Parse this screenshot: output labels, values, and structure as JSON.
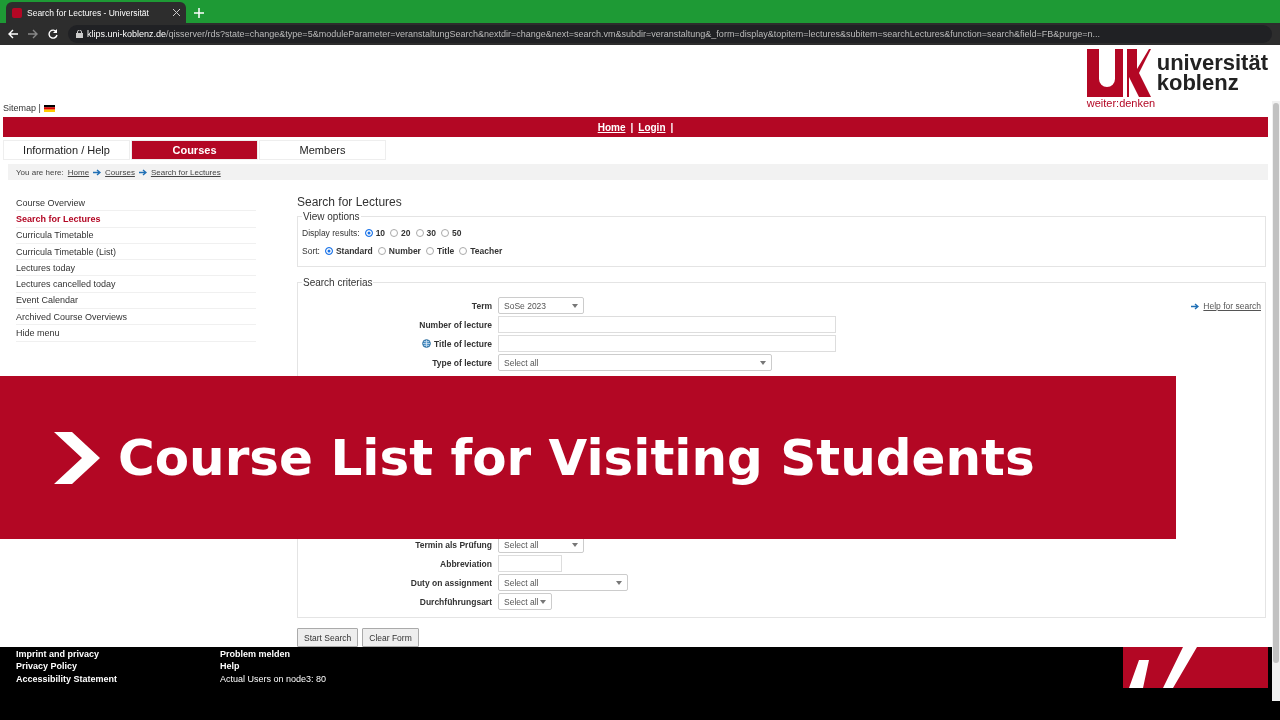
{
  "browser": {
    "tab_title": "Search for Lectures - Universität",
    "url_host": "klips.uni-koblenz.de",
    "url_path": "/qisserver/rds?state=change&type=5&moduleParameter=veranstaltungSearch&nextdir=change&next=search.vm&subdir=veranstaltung&_form=display&topitem=lectures&subitem=searchLectures&function=search&field=FB&purge=n..."
  },
  "header": {
    "sitemap": "Sitemap |",
    "logo_line1": "universität",
    "logo_line2": "koblenz",
    "tagline": "weiter:denken"
  },
  "topbar_links": [
    "Home",
    "Login"
  ],
  "topbar_separator": "|",
  "nav_tabs": [
    {
      "label": "Information / Help",
      "selected": false
    },
    {
      "label": "Courses",
      "selected": true
    },
    {
      "label": "Members",
      "selected": false
    }
  ],
  "breadcrumb": {
    "prefix": "You are here:",
    "items": [
      "Home",
      "Courses",
      "Search for Lectures"
    ]
  },
  "sidebar": {
    "items": [
      {
        "label": "Course Overview",
        "selected": false
      },
      {
        "label": "Search for Lectures",
        "selected": true
      },
      {
        "label": "Curricula Timetable",
        "selected": false
      },
      {
        "label": "Curricula Timetable (List)",
        "selected": false
      },
      {
        "label": "Lectures today",
        "selected": false
      },
      {
        "label": "Lectures cancelled today",
        "selected": false
      },
      {
        "label": "Event Calendar",
        "selected": false
      },
      {
        "label": "Archived Course Overviews",
        "selected": false
      },
      {
        "label": "Hide menu",
        "selected": false
      }
    ]
  },
  "main": {
    "title": "Search for Lectures",
    "view_options": {
      "legend": "View options",
      "display_label": "Display results:",
      "display_options": [
        {
          "label": "10",
          "selected": true
        },
        {
          "label": "20",
          "selected": false
        },
        {
          "label": "30",
          "selected": false
        },
        {
          "label": "50",
          "selected": false
        }
      ],
      "sort_label": "Sort:",
      "sort_options": [
        {
          "label": "Standard",
          "selected": true
        },
        {
          "label": "Number",
          "selected": false
        },
        {
          "label": "Title",
          "selected": false
        },
        {
          "label": "Teacher",
          "selected": false
        }
      ]
    },
    "search": {
      "legend": "Search criterias",
      "help_link": "Help for search",
      "fields_top": [
        {
          "label": "Term",
          "kind": "select",
          "value": "SoSe 2023"
        },
        {
          "label": "Number of lecture",
          "kind": "text"
        },
        {
          "label": "Title of lecture",
          "kind": "text-globe"
        },
        {
          "label": "Type of lecture",
          "kind": "select",
          "value": "Select all"
        }
      ],
      "fields_bottom": [
        {
          "label": "Termin als Prüfung",
          "kind": "select",
          "value": "Select all"
        },
        {
          "label": "Abbreviation",
          "kind": "text"
        },
        {
          "label": "Duty on assignment",
          "kind": "select",
          "value": "Select all"
        },
        {
          "label": "Durchführungsart",
          "kind": "select",
          "value": "Select all"
        }
      ]
    },
    "buttons": [
      "Start Search",
      "Clear Form"
    ]
  },
  "footer": {
    "column_1": [
      "Imprint and privacy",
      "Privacy Policy",
      "Accessibility Statement"
    ],
    "column_2": [
      "Problem melden",
      "Help",
      "Actual Users on node3: 80"
    ]
  },
  "banner": {
    "title": "Course List for Visiting Students"
  }
}
